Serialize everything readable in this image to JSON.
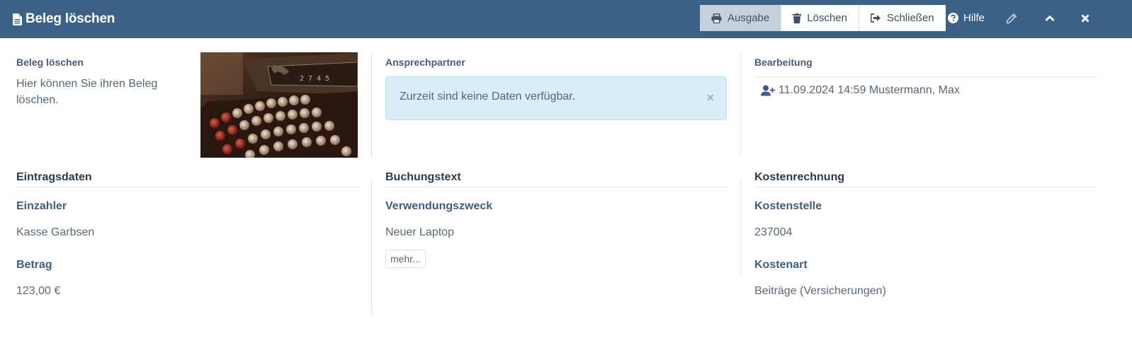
{
  "header": {
    "title": "Beleg löschen",
    "buttons": [
      {
        "label": "Ausgabe",
        "icon": "print-icon"
      },
      {
        "label": "Löschen",
        "icon": "trash-icon"
      },
      {
        "label": "Schließen",
        "icon": "sign-out-icon"
      }
    ],
    "help_label": "Hilfe",
    "colors": {
      "bar": "#3c6186",
      "active_button": "#c6d0db"
    }
  },
  "intro": {
    "label": "Beleg löschen",
    "description": "Hier können Sie ihren Beleg löschen."
  },
  "contact": {
    "label": "Ansprechpartner",
    "alert_text": "Zurzeit sind keine Daten verfügbar."
  },
  "processing": {
    "label": "Bearbeitung",
    "entry": "11.09.2024 14:59 Mustermann, Max"
  },
  "entry_data": {
    "title": "Eintragsdaten",
    "payer_label": "Einzahler",
    "payer_value": "Kasse Garbsen",
    "amount_label": "Betrag",
    "amount_value": "123,00 €"
  },
  "booking_text": {
    "title": "Buchungstext",
    "purpose_label": "Verwendungszweck",
    "purpose_value": "Neuer Laptop",
    "more_label": "mehr..."
  },
  "cost_accounting": {
    "title": "Kostenrechnung",
    "cost_center_label": "Kostenstelle",
    "cost_center_value": "237004",
    "cost_type_label": "Kostenart",
    "cost_type_value": "Beiträge (Versicherungen)"
  }
}
